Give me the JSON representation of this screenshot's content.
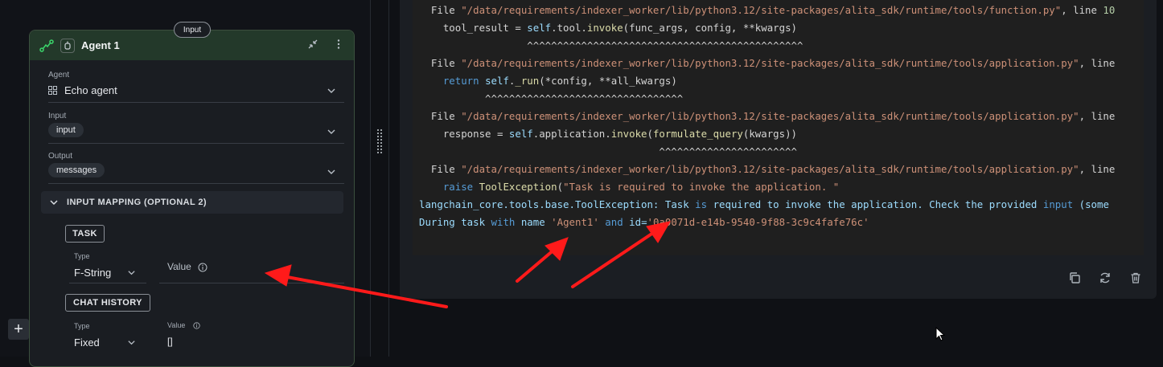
{
  "node": {
    "title": "Agent 1",
    "input_tag": "Input",
    "agent": {
      "label": "Agent",
      "value": "Echo agent"
    },
    "input": {
      "label": "Input",
      "chip": "input"
    },
    "output": {
      "label": "Output",
      "chip": "messages"
    },
    "mapping_title": "INPUT MAPPING (OPTIONAL 2)",
    "task_button": "TASK",
    "task": {
      "type_label": "Type",
      "type_value": "F-String",
      "value_label": "Value"
    },
    "chat_history_button": "CHAT HISTORY",
    "chat_history": {
      "type_label": "Type",
      "type_value": "Fixed",
      "value_label": "Value",
      "value": "[]"
    }
  },
  "code_lines": [
    [
      {
        "t": "  File ",
        "c": "plain"
      },
      {
        "t": "\"/data/requirements/indexer_worker/lib/python3.12/site-packages/alita_sdk/runtime/tools/function.py\"",
        "c": "str"
      },
      {
        "t": ", line ",
        "c": "plain"
      },
      {
        "t": "10",
        "c": "num"
      }
    ],
    [
      {
        "t": "    tool_result = ",
        "c": "plain"
      },
      {
        "t": "self",
        "c": "cy"
      },
      {
        "t": ".tool.",
        "c": "plain"
      },
      {
        "t": "invoke",
        "c": "fn"
      },
      {
        "t": "(func_args, config, **kwargs)",
        "c": "plain"
      }
    ],
    [
      {
        "t": "                  ^^^^^^^^^^^^^^^^^^^^^^^^^^^^^^^^^^^^^^^^^^^^^^",
        "c": "plain"
      }
    ],
    [
      {
        "t": "  File ",
        "c": "plain"
      },
      {
        "t": "\"/data/requirements/indexer_worker/lib/python3.12/site-packages/alita_sdk/runtime/tools/application.py\"",
        "c": "str"
      },
      {
        "t": ", line",
        "c": "plain"
      }
    ],
    [
      {
        "t": "    return ",
        "c": "kw"
      },
      {
        "t": "self",
        "c": "cy"
      },
      {
        "t": ".",
        "c": "plain"
      },
      {
        "t": "_run",
        "c": "fn"
      },
      {
        "t": "(*config, **all_kwargs)",
        "c": "plain"
      }
    ],
    [
      {
        "t": "           ^^^^^^^^^^^^^^^^^^^^^^^^^^^^^^^^^",
        "c": "plain"
      }
    ],
    [
      {
        "t": "  File ",
        "c": "plain"
      },
      {
        "t": "\"/data/requirements/indexer_worker/lib/python3.12/site-packages/alita_sdk/runtime/tools/application.py\"",
        "c": "str"
      },
      {
        "t": ", line",
        "c": "plain"
      }
    ],
    [
      {
        "t": "    response = ",
        "c": "plain"
      },
      {
        "t": "self",
        "c": "cy"
      },
      {
        "t": ".application.",
        "c": "plain"
      },
      {
        "t": "invoke",
        "c": "fn"
      },
      {
        "t": "(",
        "c": "plain"
      },
      {
        "t": "formulate_query",
        "c": "fn"
      },
      {
        "t": "(kwargs))",
        "c": "plain"
      }
    ],
    [
      {
        "t": "                                        ^^^^^^^^^^^^^^^^^^^^^^^",
        "c": "plain"
      }
    ],
    [
      {
        "t": "  File ",
        "c": "plain"
      },
      {
        "t": "\"/data/requirements/indexer_worker/lib/python3.12/site-packages/alita_sdk/runtime/tools/application.py\"",
        "c": "str"
      },
      {
        "t": ", line",
        "c": "plain"
      }
    ],
    [
      {
        "t": "    raise ",
        "c": "kw"
      },
      {
        "t": "ToolException",
        "c": "fn"
      },
      {
        "t": "(",
        "c": "plain"
      },
      {
        "t": "\"Task is required to invoke the application. \"",
        "c": "str"
      }
    ],
    [
      {
        "t": "langchain_core.tools.base.ToolException: ",
        "c": "cy"
      },
      {
        "t": "Task ",
        "c": "cy"
      },
      {
        "t": "is ",
        "c": "kw"
      },
      {
        "t": "required to invoke the application. Check the provided ",
        "c": "cy"
      },
      {
        "t": "input ",
        "c": "kw"
      },
      {
        "t": "(some",
        "c": "cy"
      }
    ],
    [
      {
        "t": "During task ",
        "c": "cy"
      },
      {
        "t": "with ",
        "c": "kw"
      },
      {
        "t": "name ",
        "c": "cy"
      },
      {
        "t": "'Agent1'",
        "c": "str"
      },
      {
        "t": " and ",
        "c": "kw"
      },
      {
        "t": "id=",
        "c": "cy"
      },
      {
        "t": "'0a0071d-e14b-9540-9f88-3c9c4fafe76c'",
        "c": "str"
      }
    ]
  ],
  "colors": {
    "accent_green": "#3bd66b",
    "arrow_red": "#ff1a1a"
  }
}
